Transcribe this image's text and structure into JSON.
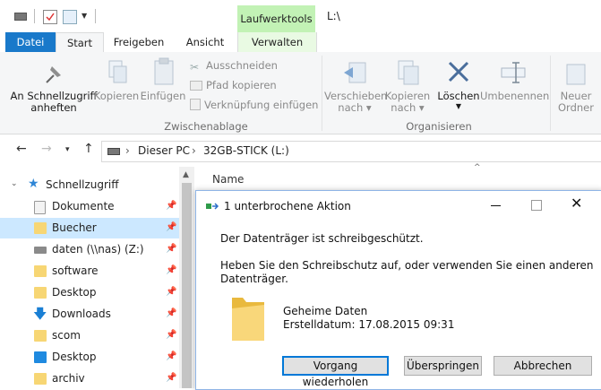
{
  "window": {
    "contextual_tab_group": "Laufwerktools",
    "title_path": "L:\\"
  },
  "tabs": [
    {
      "label": "Datei"
    },
    {
      "label": "Start"
    },
    {
      "label": "Freigeben"
    },
    {
      "label": "Ansicht"
    },
    {
      "label": "Verwalten"
    }
  ],
  "ribbon": {
    "pin_quick_access": "An Schnellzugriff",
    "pin_quick_access_2": "anheften",
    "copy": "Kopieren",
    "paste": "Einfügen",
    "cut": "Ausschneiden",
    "copy_path": "Pfad kopieren",
    "paste_shortcut": "Verknüpfung einfügen",
    "group_clipboard": "Zwischenablage",
    "move_to": "Verschieben",
    "move_to_2": "nach",
    "copy_to": "Kopieren",
    "copy_to_2": "nach",
    "delete": "Löschen",
    "rename": "Umbenennen",
    "group_organize": "Organisieren",
    "new_folder": "Neuer",
    "new_folder_2": "Ordner"
  },
  "address": {
    "crumb_1": "Dieser PC",
    "crumb_2": "32GB-STICK (L:)"
  },
  "nav": {
    "quick_access": "Schnellzugriff",
    "items": [
      {
        "label": "Dokumente"
      },
      {
        "label": "Buecher"
      },
      {
        "label": "daten (\\\\nas) (Z:)"
      },
      {
        "label": "software"
      },
      {
        "label": "Desktop"
      },
      {
        "label": "Downloads"
      },
      {
        "label": "scom"
      },
      {
        "label": "Desktop"
      },
      {
        "label": "archiv"
      }
    ]
  },
  "content": {
    "column_name": "Name"
  },
  "dialog": {
    "title": "1 unterbrochene Aktion",
    "message_1": "Der Datenträger ist schreibgeschützt.",
    "message_2": "Heben Sie den Schreibschutz auf, oder verwenden Sie einen anderen",
    "message_3": "Datenträger.",
    "item_name": "Geheime Daten",
    "item_date": "Erstelldatum: 17.08.2015 09:31",
    "btn_retry": "Vorgang wiederholen",
    "btn_skip": "Überspringen",
    "btn_cancel": "Abbrechen"
  },
  "colors": {
    "accent": "#1979ca",
    "contextual": "#c2f2b5",
    "selection": "#cce8ff",
    "folder": "#f7d674"
  }
}
